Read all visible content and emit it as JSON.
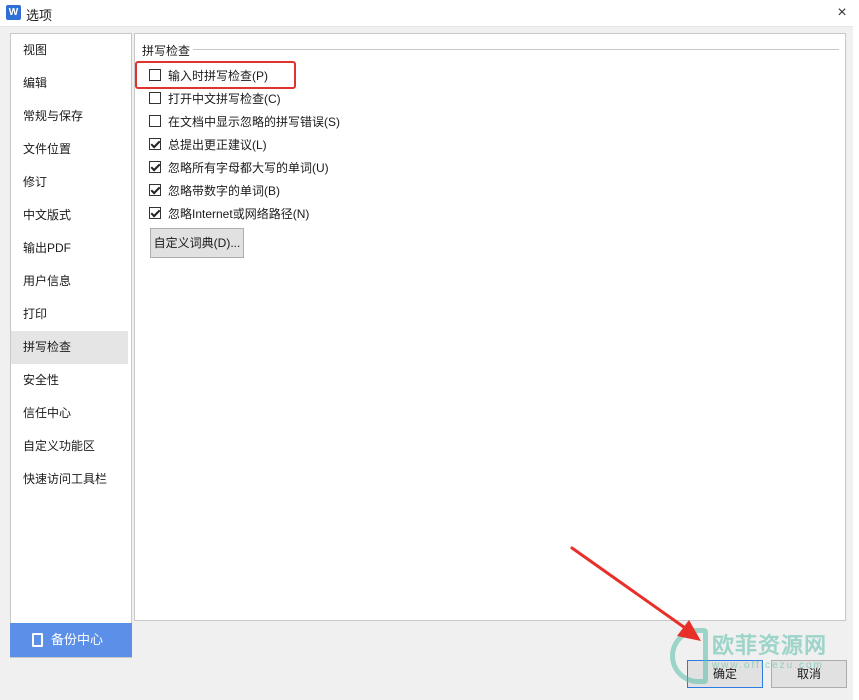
{
  "window": {
    "app_icon_glyph": "W",
    "title": "选项",
    "close_glyph": "×"
  },
  "sidebar": {
    "items": [
      {
        "label": "视图",
        "active": false
      },
      {
        "label": "编辑",
        "active": false
      },
      {
        "label": "常规与保存",
        "active": false
      },
      {
        "label": "文件位置",
        "active": false
      },
      {
        "label": "修订",
        "active": false
      },
      {
        "label": "中文版式",
        "active": false
      },
      {
        "label": "输出PDF",
        "active": false
      },
      {
        "label": "用户信息",
        "active": false
      },
      {
        "label": "打印",
        "active": false
      },
      {
        "label": "拼写检查",
        "active": true
      },
      {
        "label": "安全性",
        "active": false
      },
      {
        "label": "信任中心",
        "active": false
      },
      {
        "label": "自定义功能区",
        "active": false
      },
      {
        "label": "快速访问工具栏",
        "active": false
      }
    ],
    "backup_label": "备份中心"
  },
  "content": {
    "section_title": "拼写检查",
    "options": [
      {
        "label": "输入时拼写检查(P)",
        "checked": false
      },
      {
        "label": "打开中文拼写检查(C)",
        "checked": false
      },
      {
        "label": "在文档中显示忽略的拼写错误(S)",
        "checked": false
      },
      {
        "label": "总提出更正建议(L)",
        "checked": true
      },
      {
        "label": "忽略所有字母都大写的单词(U)",
        "checked": true
      },
      {
        "label": "忽略带数字的单词(B)",
        "checked": true
      },
      {
        "label": "忽略Internet或网络路径(N)",
        "checked": true
      }
    ],
    "dict_button_label": "自定义词典(D)..."
  },
  "footer": {
    "ok_label": "确定",
    "cancel_label": "取消"
  },
  "watermark": {
    "text": "欧菲资源网",
    "url": "www.officezu.com"
  },
  "colors": {
    "accent": "#2c7be5",
    "backup_button": "#5b8fe8",
    "highlight": "#e0332f"
  }
}
